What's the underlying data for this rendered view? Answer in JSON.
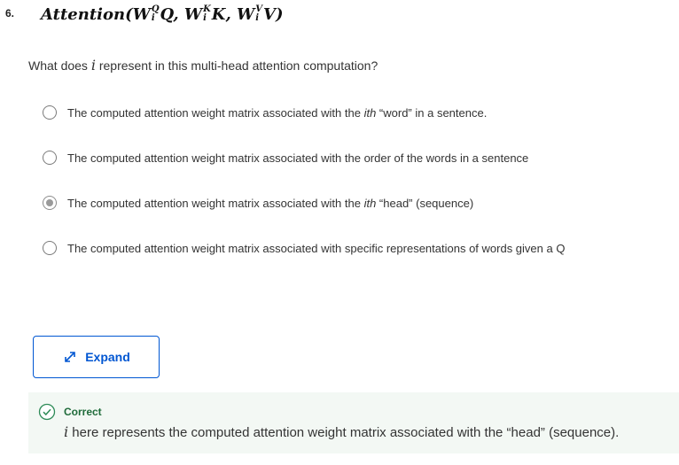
{
  "question": {
    "number": "6.",
    "formula": {
      "fn": "Attention",
      "open": "(",
      "w1": "W",
      "w1_sup": "Q",
      "w1_sub": "i",
      "a1": "Q",
      "sep1": ", ",
      "w2": "W",
      "w2_sup": "K",
      "w2_sub": "i",
      "a2": "K",
      "sep2": ", ",
      "w3": "W",
      "w3_sup": "V",
      "w3_sub": "i",
      "a3": "V",
      "close": ")"
    },
    "prompt_before": "What does ",
    "prompt_var": "i",
    "prompt_after": " represent in this multi-head attention computation?"
  },
  "options": [
    {
      "pre": "The computed attention weight matrix associated with the ",
      "em": "ith",
      "post": " “word” in a sentence.",
      "selected": false
    },
    {
      "pre": "The computed attention weight matrix associated with the order of the words in a sentence",
      "em": "",
      "post": "",
      "selected": false
    },
    {
      "pre": "The computed attention weight matrix associated with the ",
      "em": "ith",
      "post": " “head” (sequence)",
      "selected": true
    },
    {
      "pre": "The computed attention weight matrix associated with specific representations of words given a Q",
      "em": "",
      "post": "",
      "selected": false
    }
  ],
  "expand": {
    "label": "Expand",
    "icon": "expand-arrows-icon"
  },
  "feedback": {
    "status": "Correct",
    "icon": "check-circle-icon",
    "var": "i",
    "text": " here represents the computed attention weight matrix associated with the  “head” (sequence)."
  },
  "colors": {
    "accent": "#0056d2",
    "correct": "#1f6b3a",
    "feedback_bg": "#f3f8f4"
  }
}
